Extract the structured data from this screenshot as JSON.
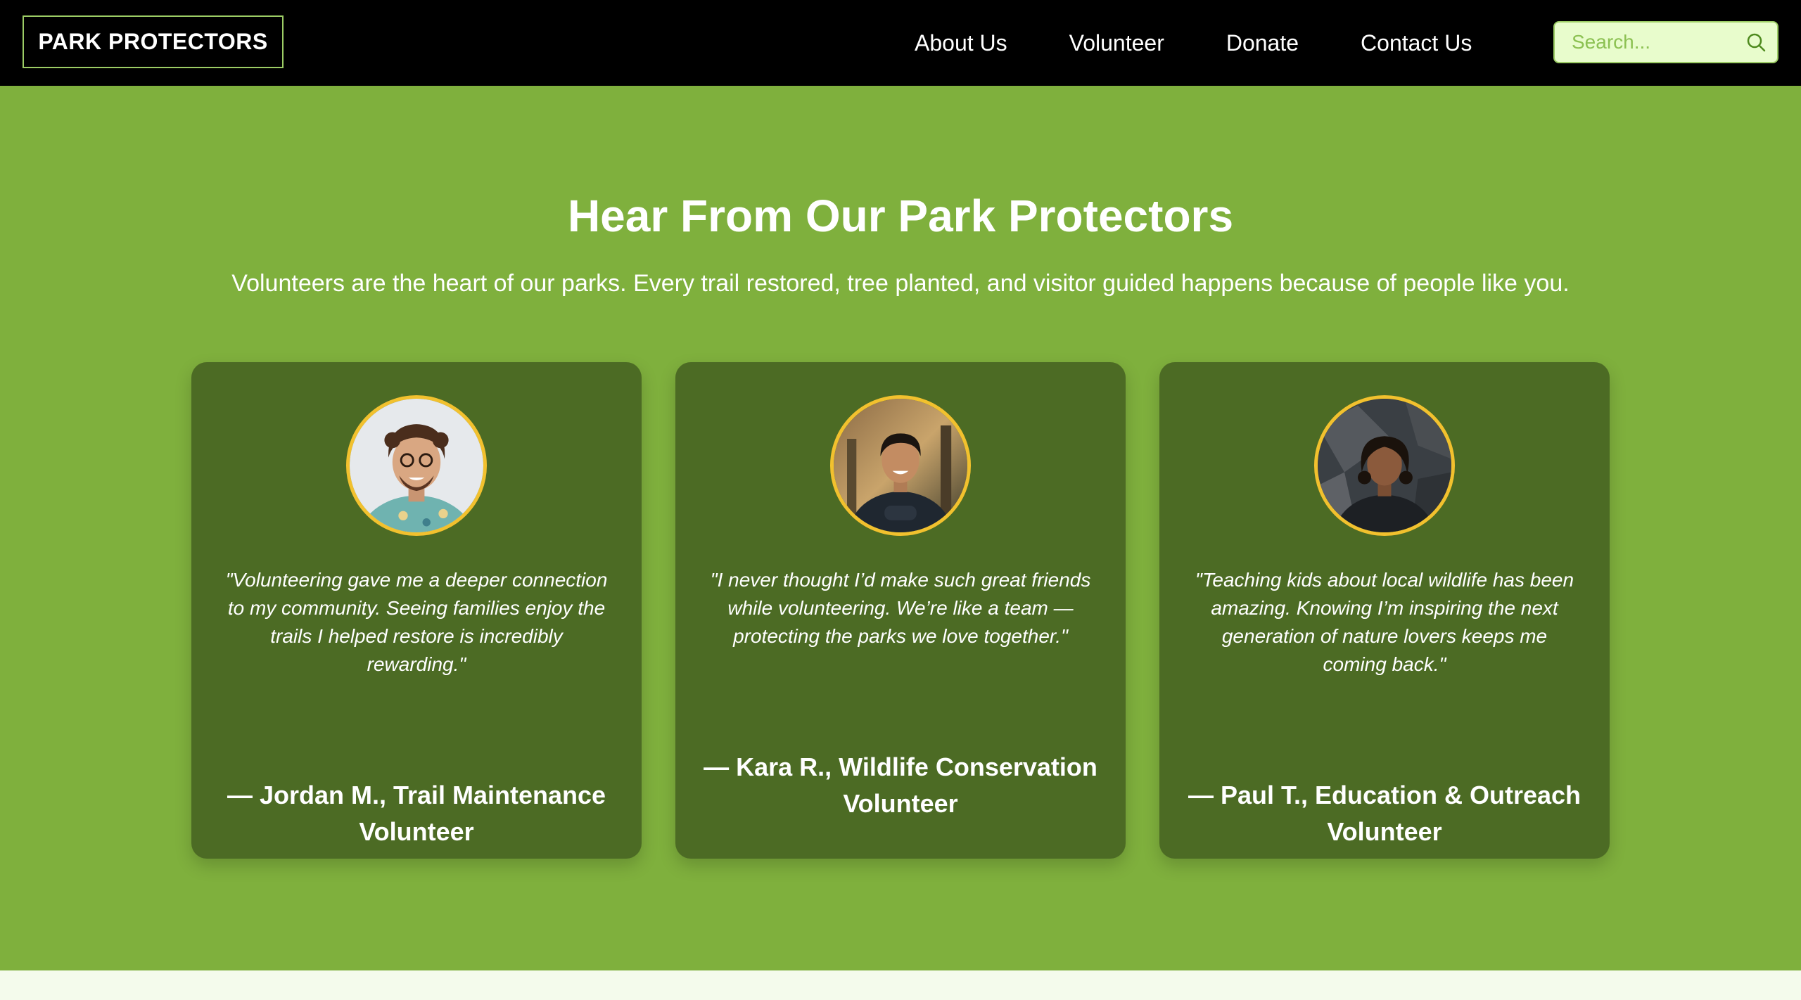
{
  "nav": {
    "logo": "PARK PROTECTORS",
    "links": [
      "About Us",
      "Volunteer",
      "Donate",
      "Contact Us"
    ],
    "search_placeholder": "Search...",
    "search_icon": "search-icon"
  },
  "section": {
    "title": "Hear From Our Park Protectors",
    "subtitle": "Volunteers are the heart of our parks. Every trail restored, tree planted, and visitor guided happens because of people like you."
  },
  "testimonials": [
    {
      "quote": "\"Volunteering gave me a deeper connection to my community. Seeing families enjoy the trails I helped restore is incredibly rewarding.\"",
      "author": "— Jordan M., Trail Maintenance Volunteer"
    },
    {
      "quote": "\"I never thought I’d make such great friends while volunteering. We’re like a team — protecting the parks we love together.\"",
      "author": "— Kara R., Wildlife Conservation Volunteer"
    },
    {
      "quote": "\"Teaching kids about local wildlife has been amazing. Knowing I’m inspiring the next generation of nature lovers keeps me coming back.\"",
      "author": "— Paul T., Education & Outreach Volunteer"
    }
  ],
  "colors": {
    "nav_bg": "#000000",
    "accent_green": "#9ccc65",
    "section_bg": "#7fb03d",
    "card_bg": "#4c6b24",
    "avatar_border": "#f2c12e",
    "footer_bg": "#f4fbec"
  }
}
